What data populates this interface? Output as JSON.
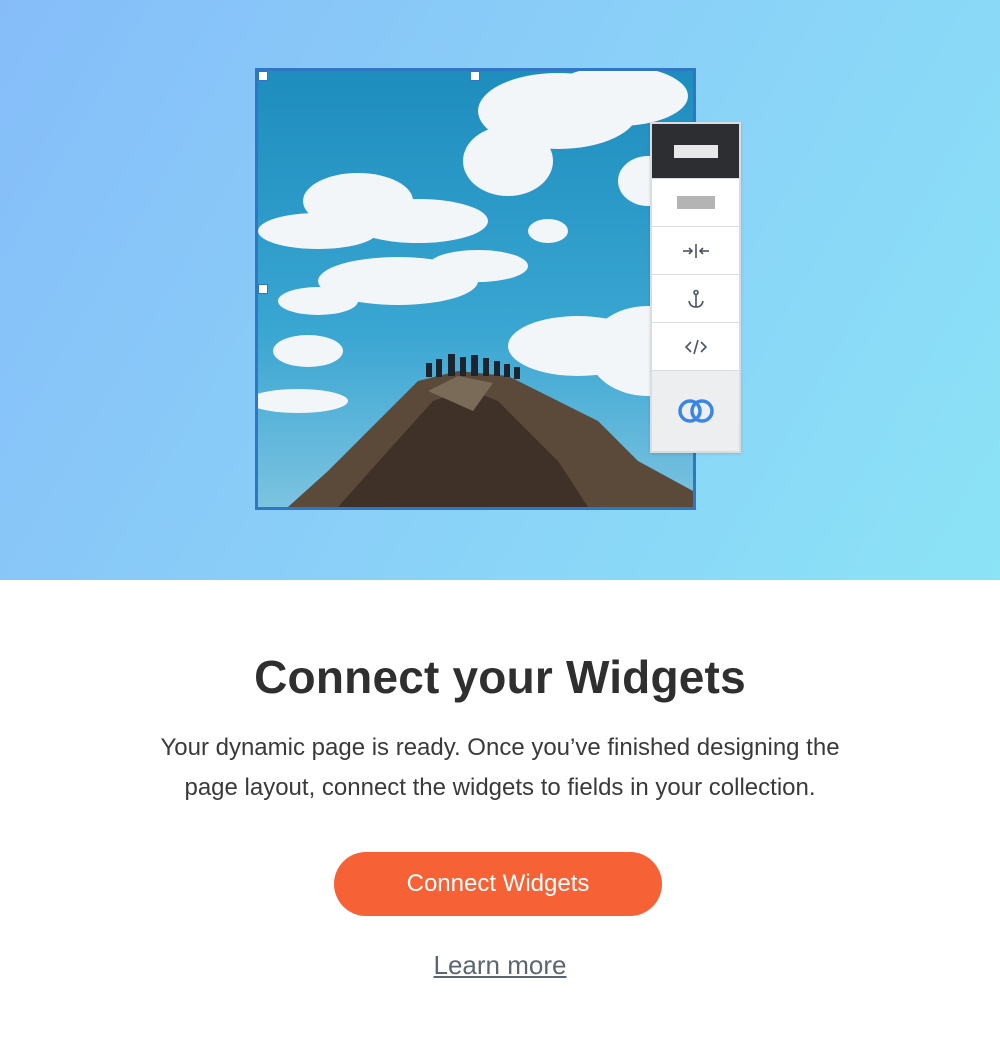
{
  "hero": {
    "toolbar": {
      "items": [
        "layout-dark",
        "layout-light",
        "stretch-icon",
        "anchor-icon",
        "embed-code-icon",
        "connect-data-icon"
      ]
    }
  },
  "content": {
    "title": "Connect your Widgets",
    "description_line1": "Your dynamic page is ready. Once you’ve finished designing the",
    "description_line2": "page layout, connect the widgets to fields in your collection.",
    "primary_button": "Connect Widgets",
    "link": "Learn more"
  },
  "colors": {
    "accent_button": "#f76136",
    "selection_blue": "#2f76c4",
    "connect_icon_blue": "#3a86e6",
    "title_text": "#2f2f2f"
  }
}
